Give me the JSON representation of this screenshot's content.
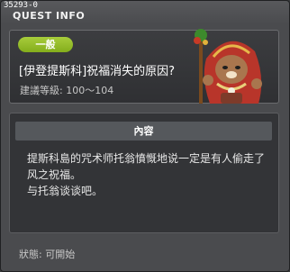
{
  "window": {
    "quest_id": "35293-0",
    "title": "QUEST INFO"
  },
  "quest": {
    "category_badge": "一般",
    "name": "[伊登提斯科]祝福消失的原因?",
    "level_requirement": "建議等級: 100～104"
  },
  "content": {
    "header": "內容",
    "body_line1": "提斯科島的咒术师托翁憤慨地说一定是有人偷走了",
    "body_line2": "风之祝福。",
    "body_line3": "与托翁谈谈吧。"
  },
  "status": {
    "text": "狀態: 可開始"
  },
  "colors": {
    "badge_green": "#93bd28",
    "panel_dark": "#333437",
    "window_bg": "#4a4b4e"
  },
  "icons": {
    "npc": "npc-shaman-portrait-icon"
  }
}
